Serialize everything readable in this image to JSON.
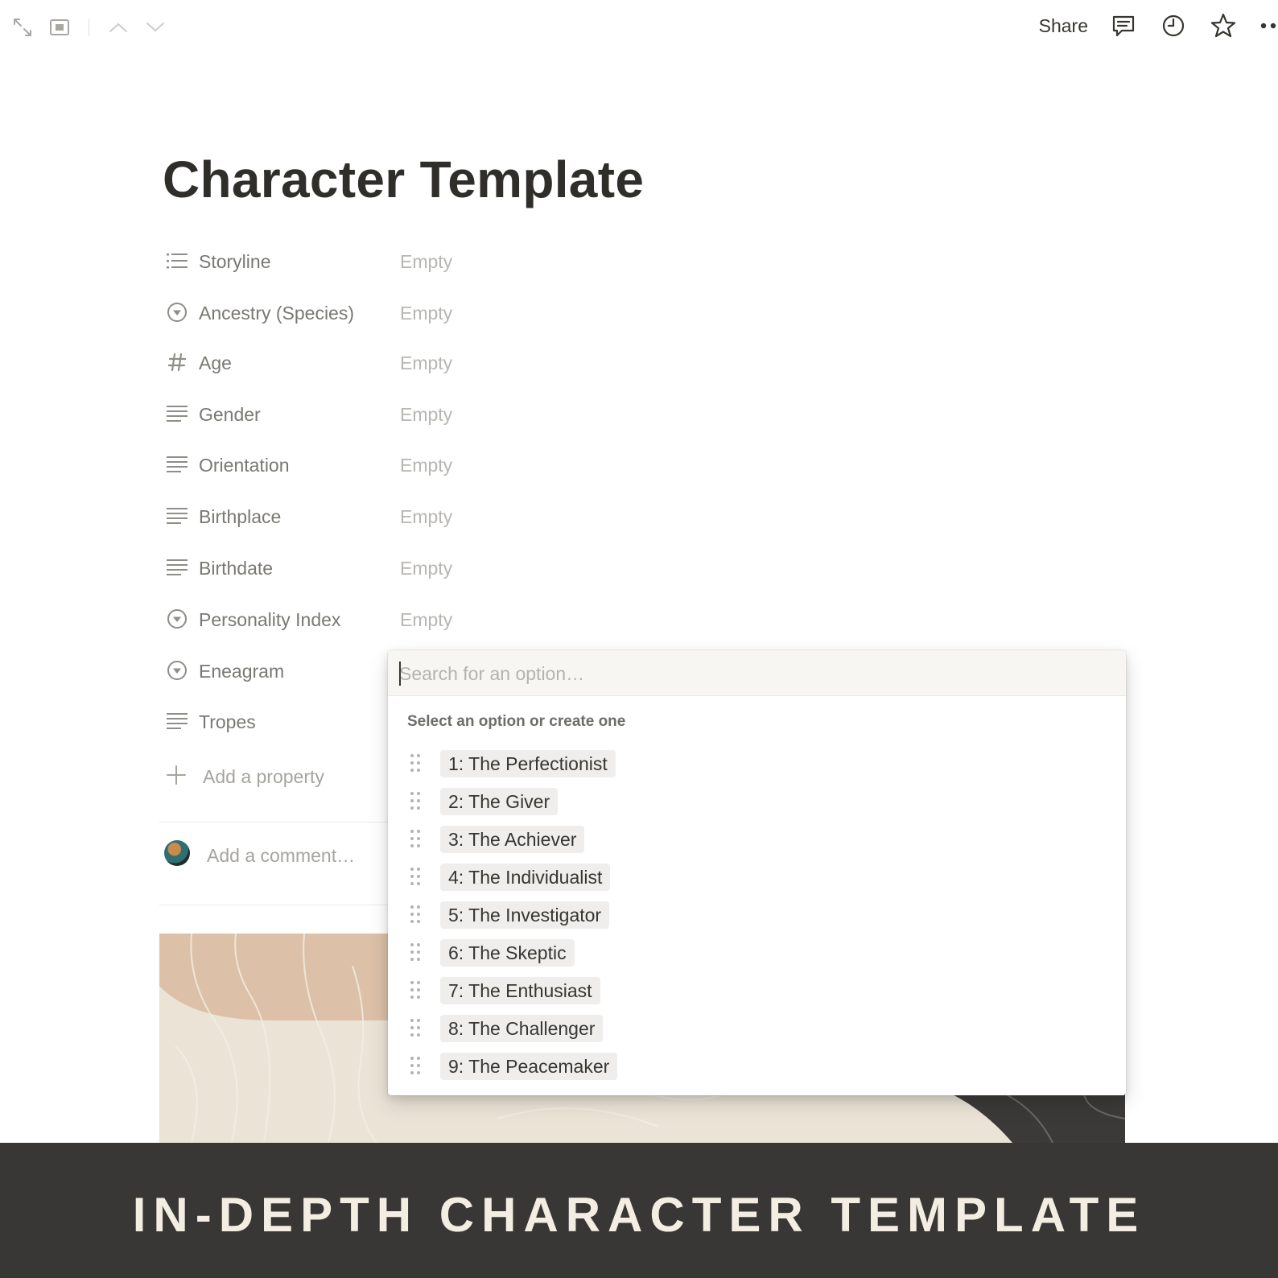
{
  "topbar": {
    "left_icons": [
      "expand-icon",
      "sidebar-toggle-icon",
      "chevron-up-icon",
      "chevron-down-icon"
    ],
    "share_label": "Share",
    "right_icons": [
      "comment-icon",
      "clock-icon",
      "star-icon",
      "more-icon"
    ]
  },
  "page": {
    "title": "Character Template"
  },
  "properties": [
    {
      "icon": "list-icon",
      "label": "Storyline",
      "value": "Empty"
    },
    {
      "icon": "select-icon",
      "label": "Ancestry (Species)",
      "value": "Empty"
    },
    {
      "icon": "number-icon",
      "label": "Age",
      "value": "Empty"
    },
    {
      "icon": "text-icon",
      "label": "Gender",
      "value": "Empty"
    },
    {
      "icon": "text-icon",
      "label": "Orientation",
      "value": "Empty"
    },
    {
      "icon": "text-icon",
      "label": "Birthplace",
      "value": "Empty"
    },
    {
      "icon": "text-icon",
      "label": "Birthdate",
      "value": "Empty"
    },
    {
      "icon": "select-icon",
      "label": "Personality Index",
      "value": "Empty"
    },
    {
      "icon": "select-icon",
      "label": "Eneagram",
      "value": ""
    },
    {
      "icon": "text-icon",
      "label": "Tropes",
      "value": ""
    }
  ],
  "add_property_label": "Add a property",
  "comment_placeholder": "Add a comment…",
  "dropdown": {
    "search_placeholder": "Search for an option…",
    "header": "Select an option or create one",
    "options": [
      "1: The Perfectionist",
      "2: The Giver",
      "3: The Achiever",
      "4: The Individualist",
      "5: The Investigator",
      "6: The Skeptic",
      "7: The Enthusiast",
      "8: The Challenger",
      "9: The Peacemaker"
    ]
  },
  "banner": {
    "text": "IN-DEPTH CHARACTER TEMPLATE"
  },
  "colors": {
    "banner_bg": "#393735",
    "banner_text": "#f3ede2",
    "cover_sand": "#ebe3d6",
    "cover_peach": "#dcc1a8",
    "cover_dark": "#3b3a38",
    "tag_bg": "#efeeec"
  }
}
